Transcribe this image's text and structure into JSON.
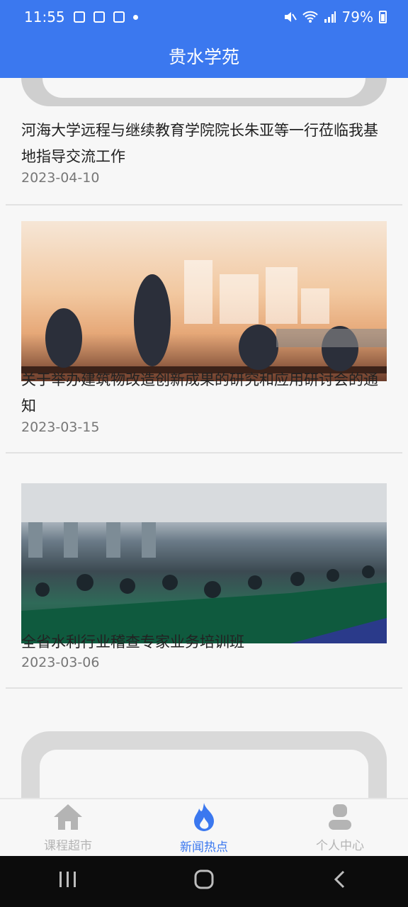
{
  "status": {
    "time": "11:55",
    "battery": "79%"
  },
  "app": {
    "title": "贵水学苑"
  },
  "news": [
    {
      "title": "河海大学远程与继续教育学院院长朱亚等一行莅临我基地指导交流工作",
      "date": "2023-04-10"
    },
    {
      "title": "关于举办建筑物改造创新成果的研究和应用研讨会的通知",
      "date": "2023-03-15"
    },
    {
      "title": "全省水利行业稽查专家业务培训班",
      "date": "2023-03-06"
    }
  ],
  "nav": [
    {
      "label": "课程超市",
      "icon": "home-icon",
      "active": false
    },
    {
      "label": "新闻热点",
      "icon": "flame-icon",
      "active": true
    },
    {
      "label": "个人中心",
      "icon": "user-icon",
      "active": false
    }
  ],
  "colors": {
    "primary": "#3b78ef",
    "inactive": "#b4b4b4"
  }
}
